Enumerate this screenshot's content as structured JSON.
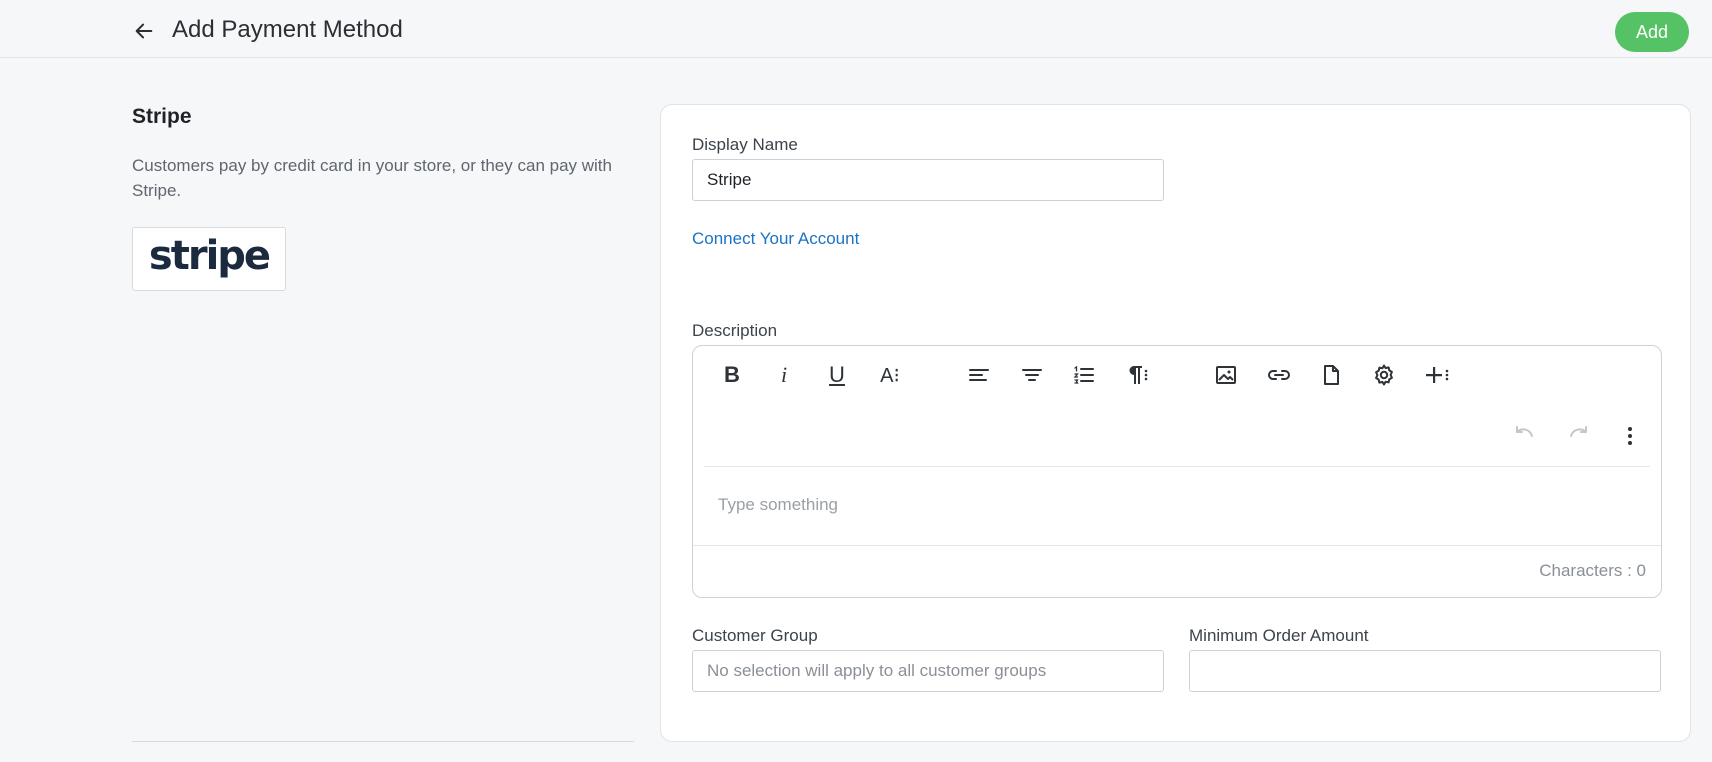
{
  "header": {
    "title": "Add Payment Method",
    "add_label": "Add"
  },
  "method": {
    "name": "Stripe",
    "description": "Customers pay by credit card in your store, or they can pay with Stripe.",
    "logo_text": "stripe"
  },
  "form": {
    "display_name_label": "Display Name",
    "display_name_value": "Stripe",
    "connect_link": "Connect Your Account",
    "description_label": "Description",
    "editor_placeholder": "Type something",
    "char_count": "Characters : 0",
    "customer_group_label": "Customer Group",
    "customer_group_placeholder": "No selection will apply to all customer groups",
    "min_order_label": "Minimum Order Amount",
    "min_order_value": ""
  },
  "toolbar": {
    "bold": "B",
    "italic": "i",
    "underline": "U",
    "font": "A⁝",
    "icons": [
      "bold-icon",
      "italic-icon",
      "underline-icon",
      "font-size-icon",
      "align-left-icon",
      "align-center-icon",
      "ordered-list-icon",
      "paragraph-icon",
      "image-icon",
      "link-icon",
      "file-icon",
      "gear-icon",
      "insert-more-icon",
      "undo-icon",
      "redo-icon",
      "more-vertical-icon"
    ]
  },
  "colors": {
    "accent_green": "#56c266",
    "link_blue": "#1a73c4",
    "stripe_navy": "#1b2a3f"
  }
}
